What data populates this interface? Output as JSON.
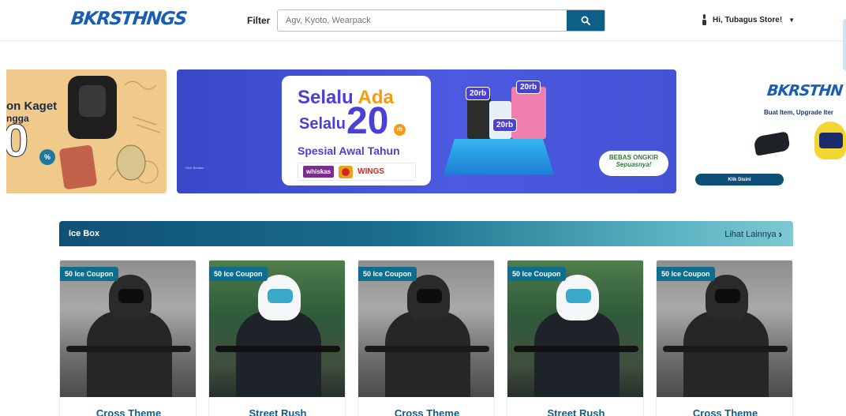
{
  "header": {
    "logo": "BKRSTHNGS",
    "filter_label": "Filter",
    "search_placeholder": "Agv, Kyoto, Wearpack",
    "user_greeting": "Hi, Tubagus Store!"
  },
  "banners": {
    "left": {
      "line1": "on Kaget",
      "line2": "ngga",
      "big": "0"
    },
    "center": {
      "line1_a": "Selalu",
      "line1_b": "Ada",
      "line2": "Selalu",
      "amount": "20",
      "amount_unit": "rb",
      "line3": "Spesial Awal Tahun",
      "brand1": "whiskas",
      "brand3": "WINGS",
      "tag": "20rb",
      "ongkir_line1": "BEBAS ONGKIR",
      "ongkir_line2": "Sepuasnya!",
      "fine_print": "*S&K Berlaku"
    },
    "right": {
      "logo": "BKRSTHN",
      "tagline": "Buat Item, Upgrade Iter",
      "button": "Klik Disini"
    }
  },
  "section": {
    "title": "Ice Box",
    "see_more": "Lihat Lainnya"
  },
  "products": [
    {
      "coupon": "50 Ice Coupon",
      "name": "Cross Theme",
      "style": "bw"
    },
    {
      "coupon": "50 Ice Coupon",
      "name": "Street Rush",
      "style": "color"
    },
    {
      "coupon": "50 Ice Coupon",
      "name": "Cross Theme",
      "style": "bw"
    },
    {
      "coupon": "50 Ice Coupon",
      "name": "Street Rush",
      "style": "color"
    },
    {
      "coupon": "50 Ice Coupon",
      "name": "Cross Theme",
      "style": "bw"
    }
  ],
  "colors": {
    "brand_blue": "#1a5eb4",
    "primary": "#0e5f86",
    "title_text": "#0f5e86"
  }
}
